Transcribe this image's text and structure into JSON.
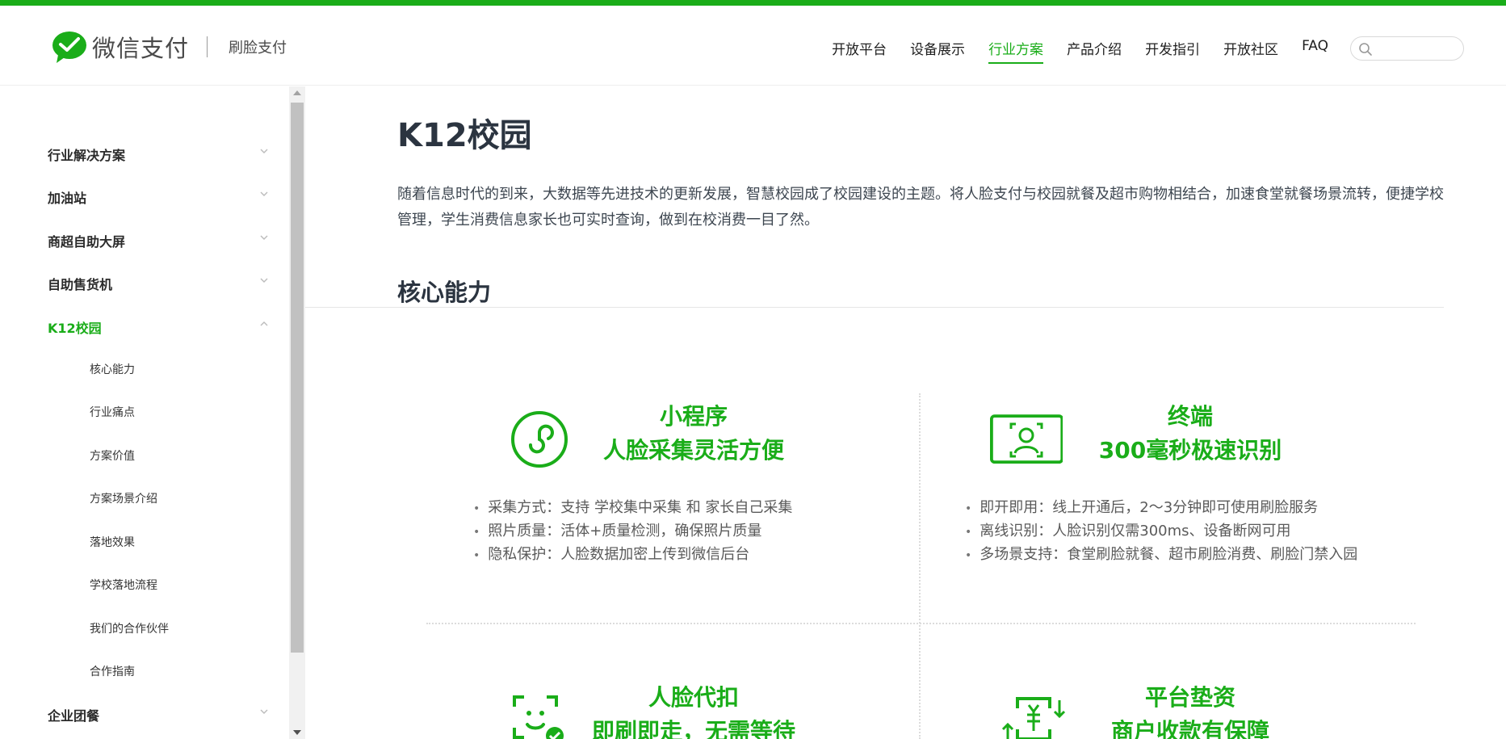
{
  "brand": {
    "name": "微信支付",
    "product": "刷脸支付",
    "accent_color": "#1aad19"
  },
  "nav": {
    "items": [
      {
        "label": "开放平台",
        "active": false
      },
      {
        "label": "设备展示",
        "active": false
      },
      {
        "label": "行业方案",
        "active": true
      },
      {
        "label": "产品介绍",
        "active": false
      },
      {
        "label": "开发指引",
        "active": false
      },
      {
        "label": "开放社区",
        "active": false
      },
      {
        "label": "FAQ",
        "active": false
      }
    ],
    "search": {
      "placeholder": "",
      "icon": "search-icon"
    }
  },
  "sidebar": {
    "items": [
      {
        "label": "行业解决方案",
        "expanded": false
      },
      {
        "label": "加油站",
        "expanded": false
      },
      {
        "label": "商超自助大屏",
        "expanded": false
      },
      {
        "label": "自助售货机",
        "expanded": false
      },
      {
        "label": "K12校园",
        "expanded": true,
        "active": true
      },
      {
        "label": "企业团餐",
        "expanded": false
      }
    ],
    "subitems": [
      "核心能力",
      "行业痛点",
      "方案价值",
      "方案场景介绍",
      "落地效果",
      "学校落地流程",
      "我们的合作伙伴",
      "合作指南"
    ]
  },
  "main": {
    "title": "K12校园",
    "intro": "随着信息时代的到来，大数据等先进技术的更新发展，智慧校园成了校园建设的主题。将人脸支付与校园就餐及超市购物相结合，加速食堂就餐场景流转，便捷学校管理，学生消费信息家长也可实时查询，做到在校消费一目了然。",
    "section_title": "核心能力",
    "features": [
      {
        "icon": "mini-program-icon",
        "title_line1": "小程序",
        "title_line2": "人脸采集灵活方便",
        "points": [
          "采集方式：支持 学校集中采集 和 家长自己采集",
          "照片质量：活体+质量检测，确保照片质量",
          "隐私保护：人脸数据加密上传到微信后台"
        ]
      },
      {
        "icon": "face-terminal-icon",
        "title_line1": "终端",
        "title_line2": "300毫秒极速识别",
        "points": [
          "即开即用：线上开通后，2～3分钟即可使用刷脸服务",
          "离线识别：人脸识别仅需300ms、设备断网可用",
          "多场景支持：食堂刷脸就餐、超市刷脸消费、刷脸门禁入园"
        ]
      },
      {
        "icon": "face-scan-check-icon",
        "title_line1": "人脸代扣",
        "title_line2": "即刷即走，无需等待",
        "points": []
      },
      {
        "icon": "platform-fund-icon",
        "title_line1": "平台垫资",
        "title_line2": "商户收款有保障",
        "points": []
      }
    ]
  }
}
